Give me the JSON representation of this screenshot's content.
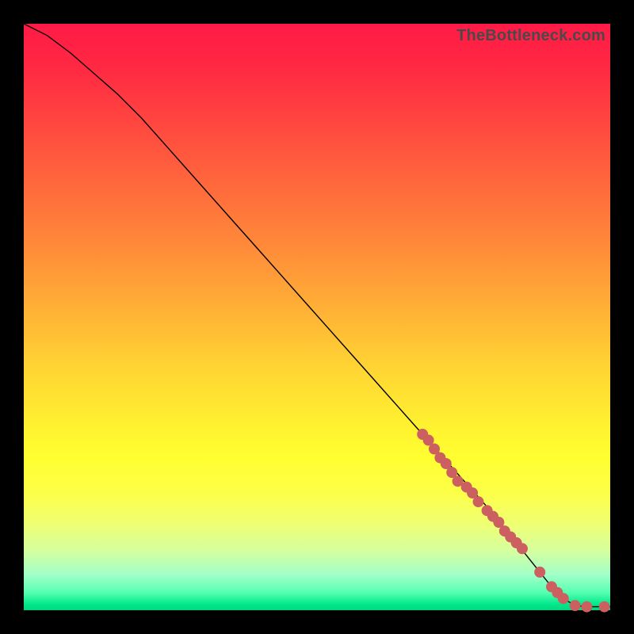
{
  "watermark": "TheBottleneck.com",
  "colors": {
    "gradient_top": "#ff1a46",
    "gradient_mid": "#fff030",
    "gradient_bottom": "#00d77f",
    "line": "#000000",
    "marker": "#cc6060",
    "frame": "#000000"
  },
  "chart_data": {
    "type": "line",
    "title": "",
    "xlabel": "",
    "ylabel": "",
    "xlim": [
      0,
      100
    ],
    "ylim": [
      0,
      100
    ],
    "grid": false,
    "legend": false,
    "x": [
      0,
      4,
      8,
      12,
      16,
      20,
      24,
      28,
      32,
      36,
      40,
      44,
      48,
      52,
      56,
      60,
      64,
      68,
      72,
      76,
      80,
      84,
      88,
      90,
      92,
      94,
      96,
      98,
      100
    ],
    "y": [
      100,
      98,
      95,
      91.5,
      88,
      84,
      79.5,
      75,
      70.5,
      66,
      61.5,
      57,
      52.5,
      48,
      43.5,
      39,
      34.5,
      30,
      25.5,
      21,
      16.5,
      11.5,
      6.5,
      4,
      2,
      0.8,
      0.6,
      0.6,
      0.6
    ],
    "markers": {
      "x": [
        68,
        69,
        70,
        71,
        72,
        73,
        74,
        75.5,
        76.5,
        77.5,
        79,
        80,
        81,
        82,
        83,
        84,
        85,
        88,
        90,
        91,
        92,
        94,
        96,
        99
      ],
      "y": [
        30,
        29,
        27.5,
        26,
        25,
        23.5,
        22,
        21,
        20,
        18.5,
        17,
        16,
        15,
        13.5,
        12.5,
        11.5,
        10.5,
        6.5,
        4,
        3,
        2,
        0.8,
        0.6,
        0.6
      ]
    }
  }
}
